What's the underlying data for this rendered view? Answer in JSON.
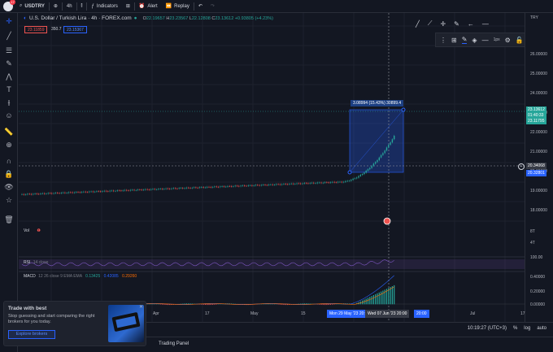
{
  "topbar": {
    "symbol": "USDTRY",
    "add_symbol_icon": "plus-circle-icon",
    "interval": "4h",
    "chart_type_icon": "candles-icon",
    "indicators_label": "Indicators",
    "layout_icon": "layout-grid-icon",
    "alert_label": "Alert",
    "replay_label": "Replay",
    "notification_count": "17"
  },
  "legend": {
    "title": "U.S. Dollar / Turkish Lira · 4h · FOREX.com",
    "open_label": "O",
    "open": "22.19657",
    "high_label": "H",
    "high": "23.23567",
    "low_label": "L",
    "low": "22.12808",
    "close_label": "C",
    "close": "23.13612",
    "change": "+0.93805 (+4.23%)",
    "sell_price": "23.11859",
    "spread": "350.7",
    "buy_price": "23.15367"
  },
  "price_axis": {
    "currency": "TRY",
    "ticks": [
      "26.00000",
      "25.00000",
      "24.00000",
      "23.00000",
      "22.00000",
      "21.00000",
      "20.00000",
      "19.00000",
      "18.00000"
    ],
    "last_price": "23.13612",
    "countdown": "01:40:33",
    "bid_price": "23.11795",
    "crosshair_price": "20.34068",
    "crosshair_price2": "20.32801"
  },
  "measure": {
    "label": "3.08994 (15.43%) 30899.4"
  },
  "panes": {
    "vol_label": "Vol",
    "vol_ticks": [
      "8T",
      "4T"
    ],
    "rsi_label": "RSI",
    "rsi_params": "14 close",
    "rsi_tick": "100.00",
    "macd_label": "MACD",
    "macd_params": "12 26 close 9 EMA EMA",
    "macd_v1": "0.13425",
    "macd_v2": "0.42085",
    "macd_v3": "0.29260",
    "macd_ticks": [
      "0.40000",
      "0.20000",
      "0.00000"
    ]
  },
  "time_axis": {
    "labels": [
      "Apr",
      "17",
      "May",
      "15",
      "Jul",
      "17"
    ],
    "tag_left": "Mon 29 May '23",
    "tag_mid": "20:00",
    "tag_cross": "Wed 07 Jun '23",
    "tag_cross_time": "20:00",
    "tag_right": "20:00"
  },
  "bottombar": {
    "clock": "10:19:27 (UTC+3)",
    "percent": "%",
    "log": "log",
    "auto": "auto"
  },
  "trading_panel": "Trading Panel",
  "promo": {
    "title": "Trade with best",
    "body": "Stop guessing and start comparing the right brokers for you today.",
    "button": "Explore brokers"
  },
  "colors": {
    "background": "#131722",
    "up": "#26a69a",
    "down": "#ef5350",
    "accent": "#2962ff",
    "rsi": "#7e57c2",
    "macd_line": "#2962ff",
    "signal_line": "#ff6d00"
  }
}
